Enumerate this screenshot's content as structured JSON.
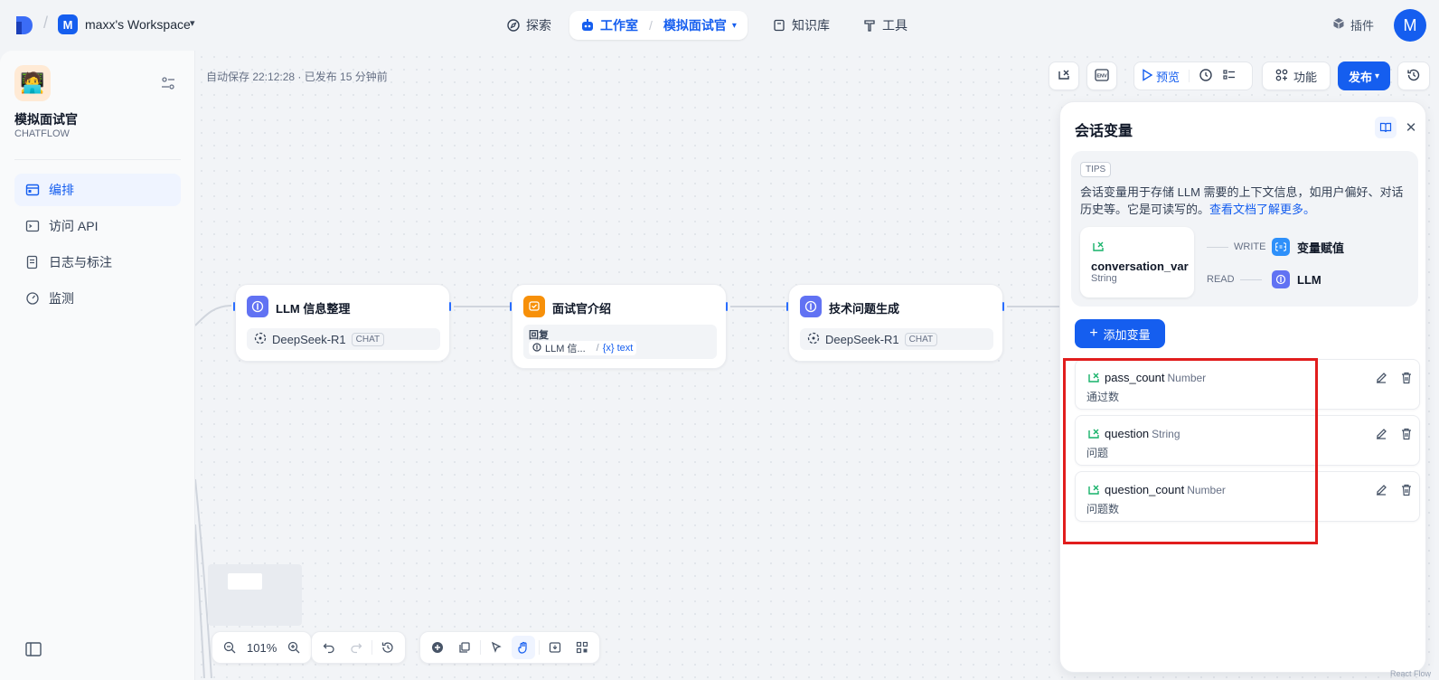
{
  "topbar": {
    "workspace_initial": "M",
    "workspace_name": "maxx's Workspace",
    "nav_explore": "探索",
    "nav_studio": "工作室",
    "nav_current_app": "模拟面试官",
    "nav_knowledge": "知识库",
    "nav_tools": "工具",
    "plugins": "插件",
    "user_initial": "M"
  },
  "sidebar": {
    "app_name": "模拟面试官",
    "app_mode": "CHATFLOW",
    "items": [
      {
        "label": "编排",
        "icon": "layout-icon",
        "active": true
      },
      {
        "label": "访问 API",
        "icon": "terminal-icon",
        "active": false
      },
      {
        "label": "日志与标注",
        "icon": "file-text-icon",
        "active": false
      },
      {
        "label": "监测",
        "icon": "gauge-icon",
        "active": false
      }
    ]
  },
  "canvas": {
    "autosave": "自动保存 22:12:28 · 已发布 15 分钟前",
    "toolbar": {
      "preview": "预览",
      "features": "功能",
      "publish": "发布"
    },
    "zoom": "101%",
    "nodes": [
      {
        "title": "LLM 信息整理",
        "model": "DeepSeek-R1",
        "badge": "CHAT"
      },
      {
        "title": "面试官介绍",
        "reply_label": "回复",
        "ref_node": "LLM 信...",
        "ref_var": "{x} text"
      },
      {
        "title": "技术问题生成",
        "model": "DeepSeek-R1",
        "badge": "CHAT"
      }
    ]
  },
  "panel": {
    "title": "会话变量",
    "tips_badge": "TIPS",
    "tips_text": "会话变量用于存储 LLM 需要的上下文信息，如用户偏好、对话历史等。它是可读写的。",
    "tips_link": "查看文档了解更多。",
    "example_var_name": "conversation_var",
    "example_var_type": "String",
    "write_label": "WRITE",
    "read_label": "READ",
    "write_node": "变量赋值",
    "read_node": "LLM",
    "add_button": "添加变量",
    "variables": [
      {
        "name": "pass_count",
        "type": "Number",
        "description": "通过数"
      },
      {
        "name": "question",
        "type": "String",
        "description": "问题"
      },
      {
        "name": "question_count",
        "type": "Number",
        "description": "问题数"
      }
    ]
  },
  "colors": {
    "accent": "#155eef",
    "llm_node": "#6172f3",
    "answer_node": "#f79009",
    "highlight": "#e11d1d"
  },
  "watermark": "React Flow"
}
